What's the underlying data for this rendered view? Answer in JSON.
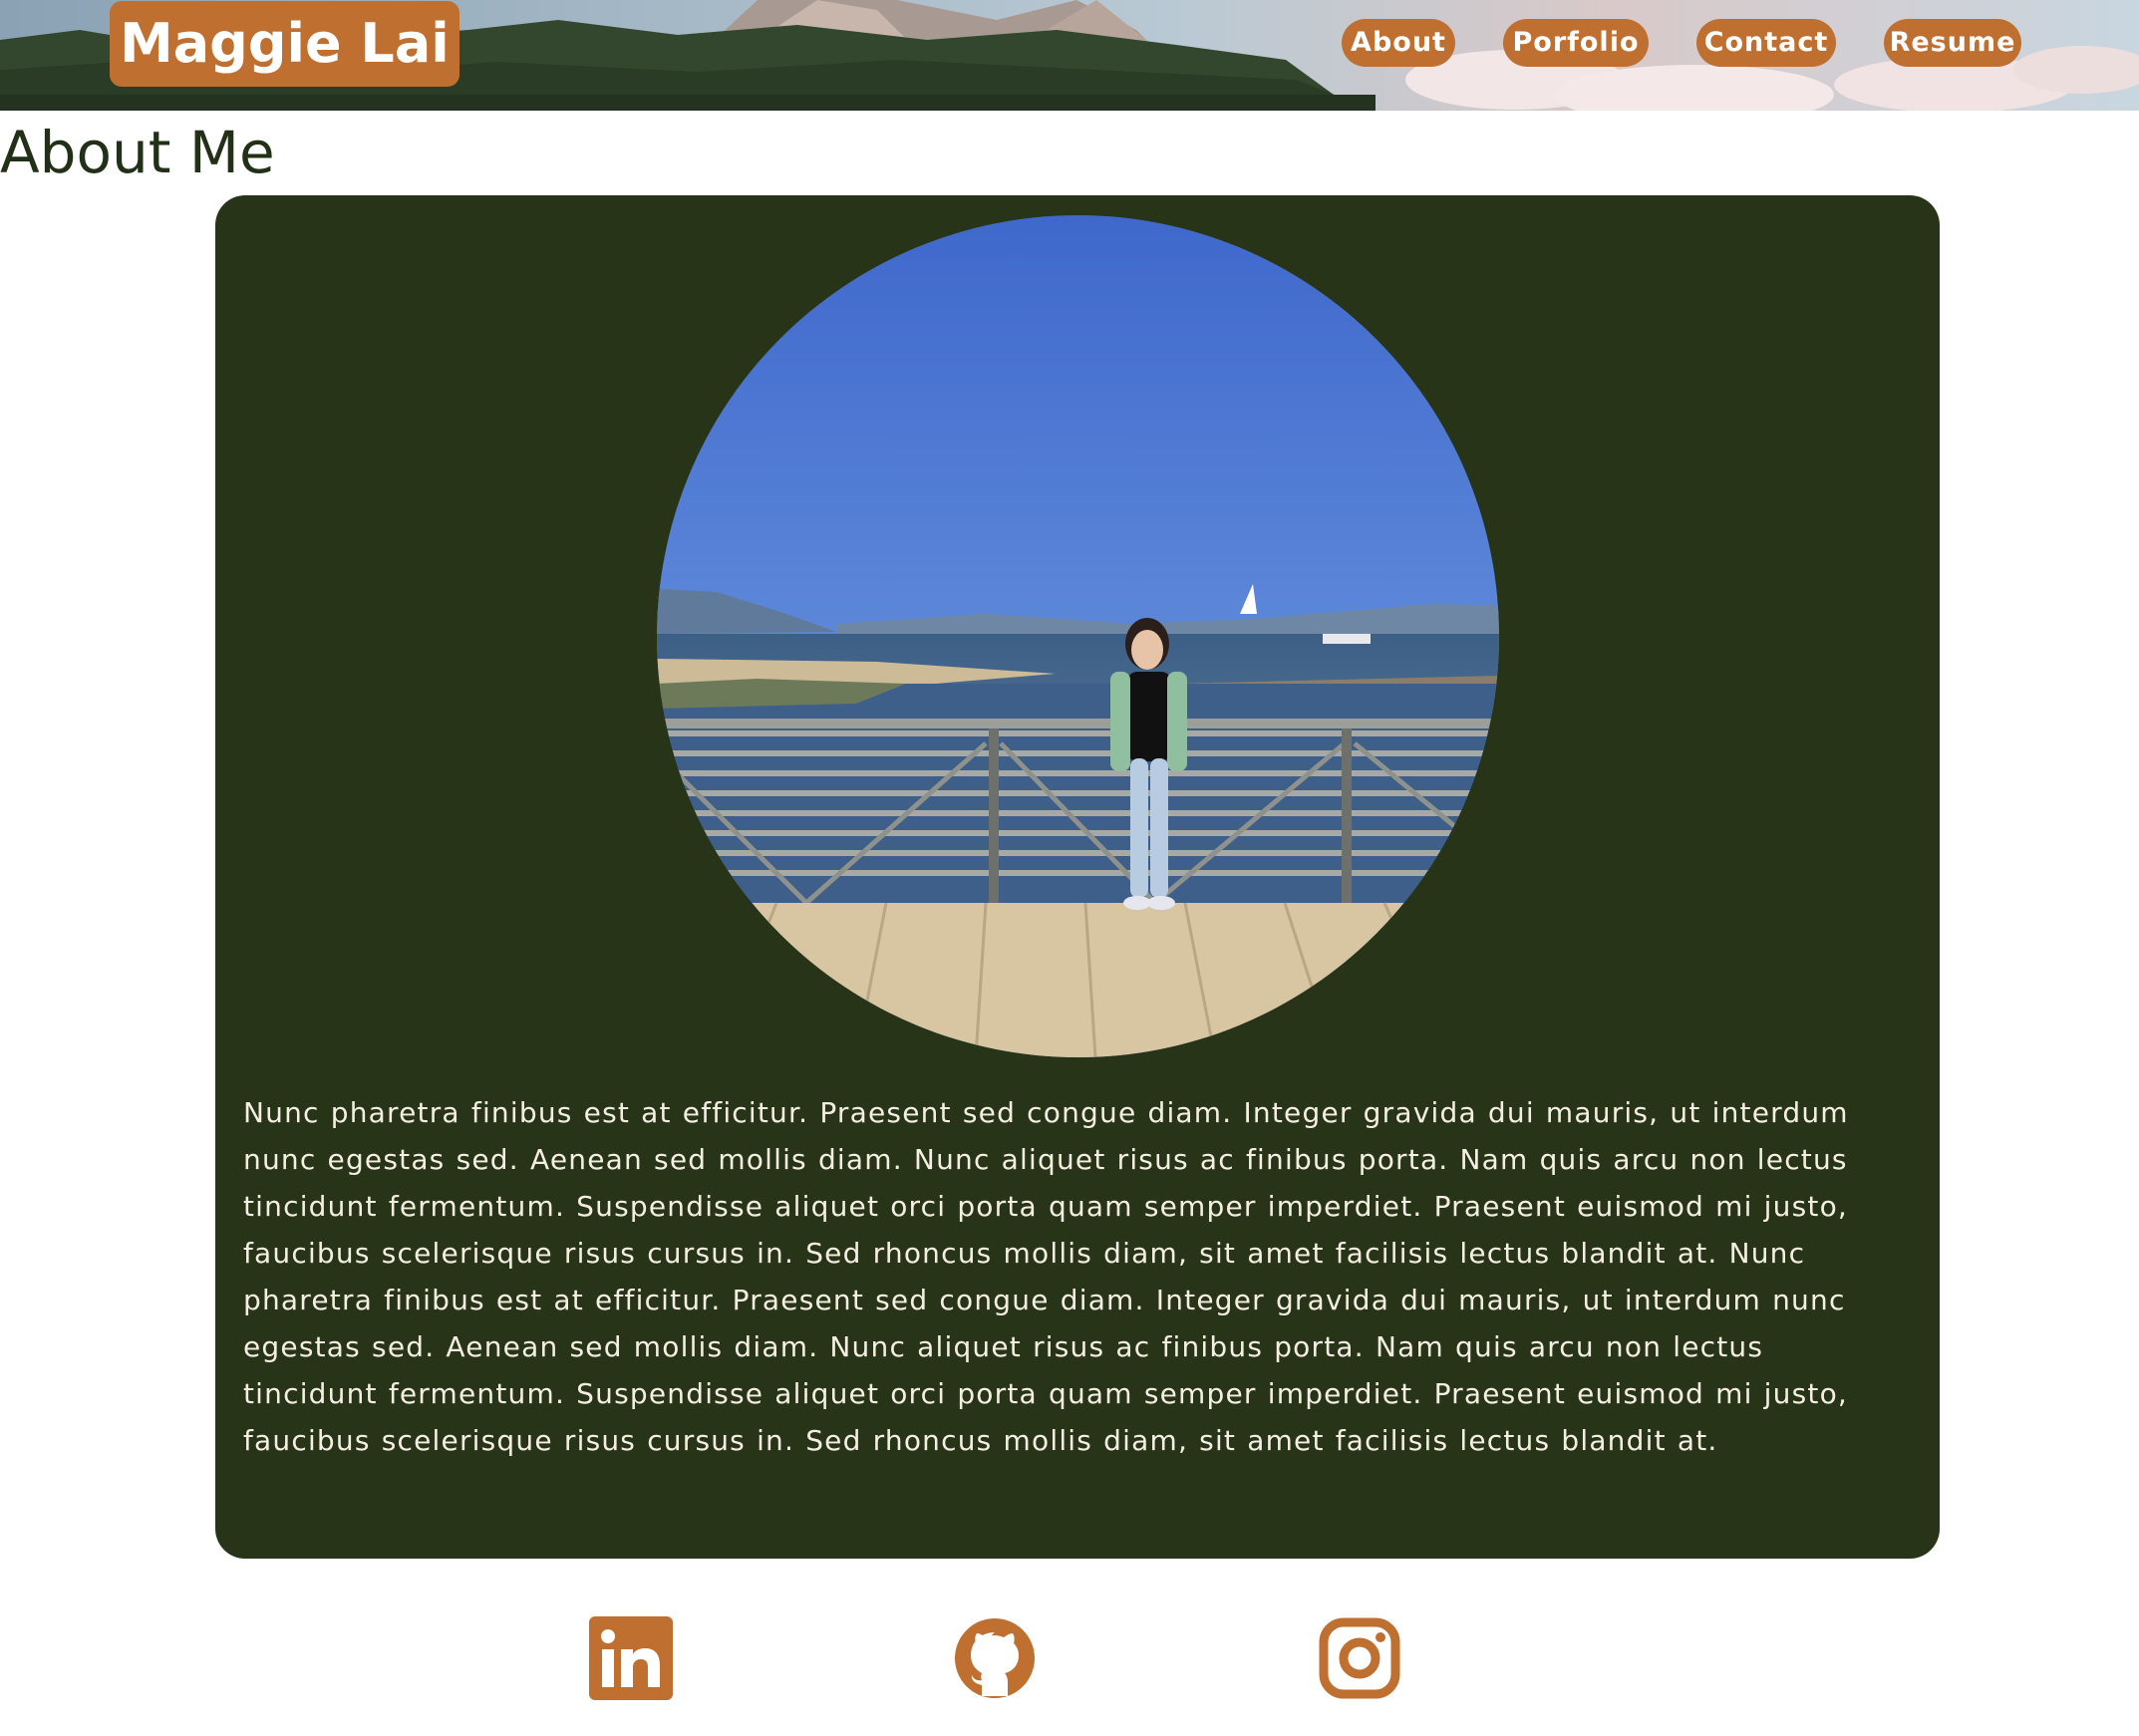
{
  "header": {
    "brand": "Maggie Lai",
    "nav": [
      {
        "label": "About"
      },
      {
        "label": "Porfolio"
      },
      {
        "label": "Contact"
      },
      {
        "label": "Resume"
      }
    ]
  },
  "main": {
    "title": "About Me",
    "bio": "Nunc pharetra finibus est at efficitur. Praesent sed congue diam. Integer gravida dui mauris, ut interdum nunc egestas sed. Aenean sed mollis diam. Nunc aliquet risus ac finibus porta. Nam quis arcu non lectus tincidunt fermentum. Suspendisse aliquet orci porta quam semper imperdiet. Praesent euismod mi justo, faucibus scelerisque risus cursus in. Sed rhoncus mollis diam, sit amet facilisis lectus blandit at. Nunc pharetra finibus est at efficitur. Praesent sed congue diam. Integer gravida dui mauris, ut interdum nunc egestas sed. Aenean sed mollis diam. Nunc aliquet risus ac finibus porta. Nam quis arcu non lectus tincidunt fermentum. Suspendisse aliquet orci porta quam semper imperdiet. Praesent euismod mi justo, faucibus scelerisque risus cursus in. Sed rhoncus mollis diam, sit amet facilisis lectus blandit at."
  },
  "social": {
    "icons": [
      "linkedin-icon",
      "github-icon",
      "instagram-icon"
    ]
  },
  "colors": {
    "accent": "#bf6f30",
    "card_bg": "#283418",
    "title_text": "#223018",
    "card_text": "#f4efe2"
  }
}
